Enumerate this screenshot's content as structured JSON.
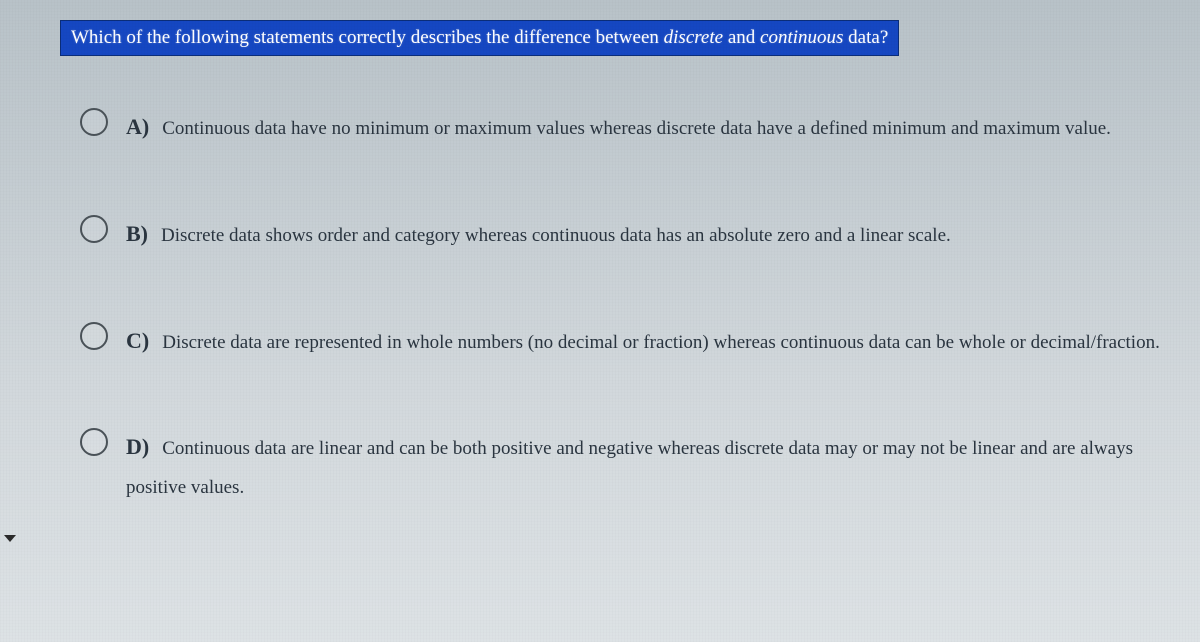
{
  "question": {
    "prefix": "Which of the following statements correctly describes the difference between ",
    "italic1": "discrete",
    "mid": " and ",
    "italic2": "continuous",
    "suffix": " data?"
  },
  "options": [
    {
      "letter": "A)",
      "text": "Continuous data have no minimum or maximum values whereas discrete data have a defined minimum and maximum value."
    },
    {
      "letter": "B)",
      "text": "Discrete data shows order and category whereas continuous data has an absolute zero and a linear scale."
    },
    {
      "letter": "C)",
      "text": "Discrete data are represented in whole numbers (no decimal or fraction) whereas continuous data can be whole or decimal/fraction."
    },
    {
      "letter": "D)",
      "text": "Continuous data are linear and can be both positive and negative whereas discrete data may or may not be linear and are always positive values."
    }
  ]
}
